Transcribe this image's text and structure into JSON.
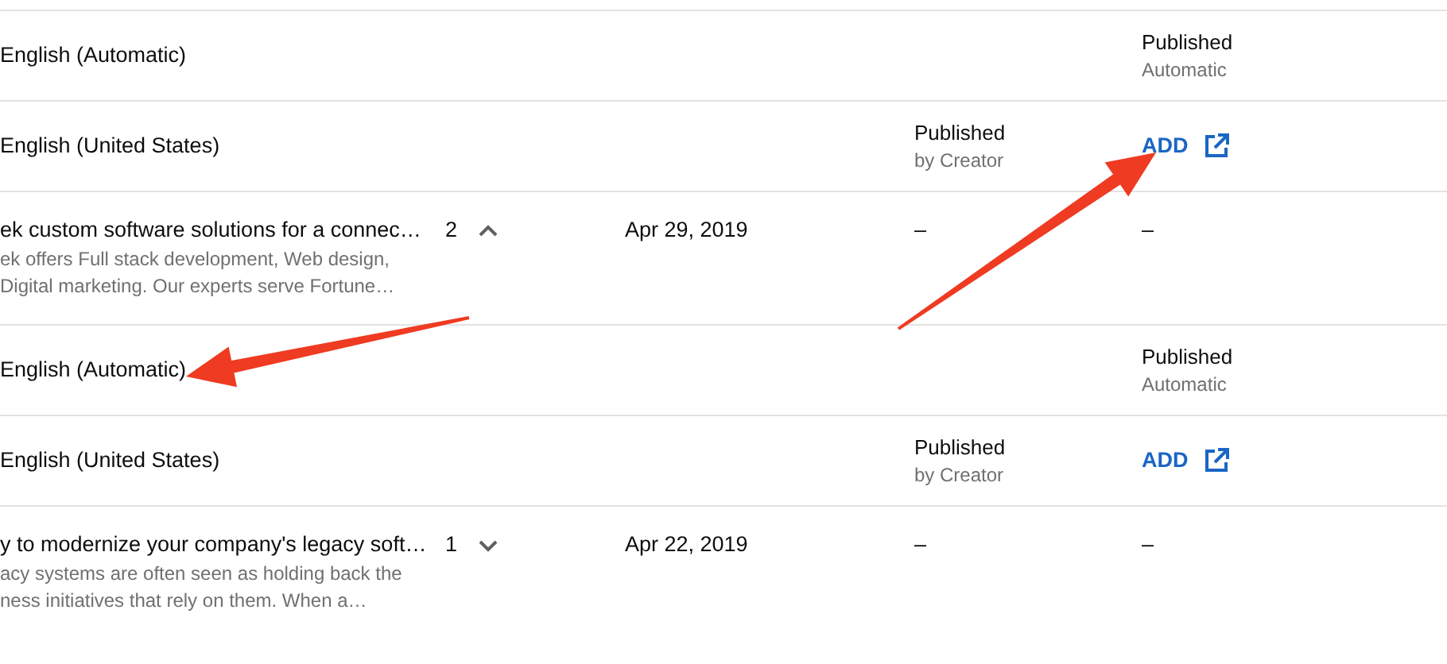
{
  "rows": [
    {
      "kind": "language",
      "language": "English (Automatic)",
      "column_5": {
        "kind": "status",
        "title": "Published",
        "sub": "Automatic"
      }
    },
    {
      "kind": "language",
      "language": "English (United States)",
      "column_4": {
        "kind": "status",
        "title": "Published",
        "sub": "by Creator"
      },
      "column_5": {
        "kind": "add",
        "label": "ADD"
      }
    },
    {
      "kind": "video",
      "title": "ek custom software solutions for a connec…",
      "description_lines": [
        "ek offers Full stack development, Web design,",
        "Digital marketing. Our experts serve Fortune…"
      ],
      "count": "2",
      "expanded": true,
      "date": "Apr 29, 2019",
      "column_4": {
        "kind": "text",
        "text": "–"
      },
      "column_5": {
        "kind": "text",
        "text": "–"
      }
    },
    {
      "kind": "language",
      "language": "English (Automatic)",
      "column_5": {
        "kind": "status",
        "title": "Published",
        "sub": "Automatic"
      }
    },
    {
      "kind": "language",
      "language": "English (United States)",
      "column_4": {
        "kind": "status",
        "title": "Published",
        "sub": "by Creator"
      },
      "column_5": {
        "kind": "add",
        "label": "ADD"
      }
    },
    {
      "kind": "video",
      "title": "y to modernize your company's legacy soft…",
      "description_lines": [
        "acy systems are often seen as holding back the",
        "ness initiatives that rely on them. When a…"
      ],
      "count": "1",
      "expanded": false,
      "date": "Apr 22, 2019",
      "column_4": {
        "kind": "text",
        "text": "–"
      },
      "column_5": {
        "kind": "text",
        "text": "–"
      }
    }
  ]
}
